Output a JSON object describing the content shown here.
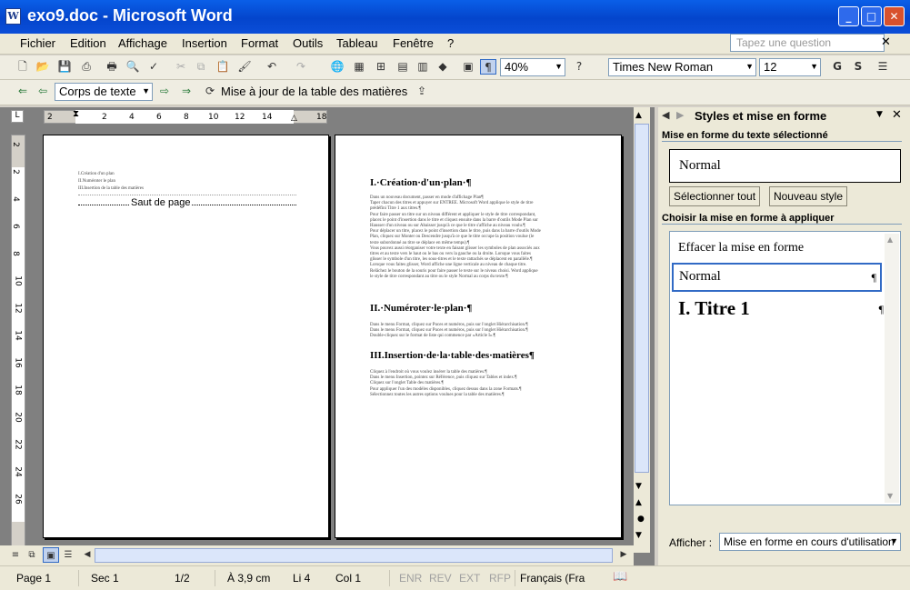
{
  "window": {
    "title": "exo9.doc - Microsoft Word"
  },
  "menu": [
    "Fichier",
    "Edition",
    "Affichage",
    "Insertion",
    "Format",
    "Outils",
    "Tableau",
    "Fenêtre",
    "?"
  ],
  "ask_placeholder": "Tapez une question",
  "toolbar": {
    "zoom": "40%",
    "font": "Times New Roman",
    "size": "12",
    "bold": "G",
    "shadow": "S"
  },
  "outline_bar": {
    "style": "Corps de texte",
    "update_toc": "Mise à jour de la table des matières"
  },
  "ruler": {
    "h": [
      "2",
      "2",
      "4",
      "6",
      "8",
      "10",
      "12",
      "14",
      "18"
    ],
    "v": [
      "2",
      "2",
      "4",
      "6",
      "8",
      "10",
      "12",
      "14",
      "16",
      "18",
      "20",
      "22",
      "24",
      "26"
    ]
  },
  "page1": {
    "toc": [
      "I.Création d'un plan",
      "II.Numéroter le plan",
      "III.Insertion de la table des matières"
    ],
    "page_break": "Saut de page"
  },
  "page2": {
    "h1": "I.·Création·d'un·plan·¶",
    "h2": "II.·Numéroter·le·plan·¶",
    "h3": "III.Insertion·de·la·table·des·matières¶",
    "p1": [
      "Dans un nouveau document, passer en mode d'affichage Plan¶",
      "Taper chacun des titres et appuyer sur ENTREE. Microsoft Word applique le style de titre",
      "prédéfini Titre 1 aux titres.¶",
      "Pour faire passer un titre sur un niveau différent et appliquer le style de titre correspondant,",
      "placez le point d'insertion dans le titre et cliquez ensuite dans la barre d'outils Mode Plan sur",
      "Hausser d'un niveau ou sur Abaisser jusqu'à ce que le titre s'affiche au niveau voulu.¶",
      "Pour déplacer un titre, placez le point d'insertion dans le titre, puis dans la barre d'outils Mode",
      "Plan, cliquez sur Monter ou Descendre jusqu'à ce que le titre occupe la position voulue (le",
      "texte subordonné au titre se déplace en même temps).¶",
      "Vous pouvez aussi réorganiser votre texte en faisant glisser les symboles de plan associés aux",
      "titres et au texte vers le haut ou le bas ou vers la gauche ou la droite. Lorsque vous faites",
      "glisser le symbole d'un titre, les sous-titres et le texte rattachés se déplacent en parallèle.¶",
      "Lorsque vous faites glisser, Word affiche une ligne verticale au niveau de chaque titre.",
      "Relâchez le bouton de la souris pour faire passer le texte sur le niveau choisi. Word applique",
      "le style de titre correspondant au titre ou le style Normal au corps du texte.¶"
    ],
    "p2": [
      "Dans le menu Format, cliquez sur Puces et numéros, puis sur l'onglet Hiérarchisation.¶",
      "Dans le menu Format, cliquez sur Puces et numéros, puis sur l'onglet Hiérarchisation.¶",
      "Double-cliquez sur le format de liste qui commence par «Article I».¶"
    ],
    "p3": [
      "Cliquez à l'endroit où vous voulez insérer la table des matières.¶",
      "Dans le menu Insertion, pointez sur Référence, puis cliquez sur Tables et index.¶",
      "Cliquez sur l'onglet Table des matières.¶",
      "Pour appliquer l'un des modèles disponibles, cliquez dessus dans la zone Formats.¶",
      "Sélectionnez toutes les autres options voulues pour la table des matières.¶"
    ]
  },
  "taskpane": {
    "title": "Styles et mise en forme",
    "sec1": "Mise en forme du texte sélectionné",
    "current": "Normal",
    "select_all": "Sélectionner tout",
    "new_style": "Nouveau style",
    "sec2": "Choisir la mise en forme à appliquer",
    "items": [
      "Effacer la mise en forme",
      "Normal",
      "I.  Titre 1"
    ],
    "pilcrow": "¶",
    "show_label": "Afficher :",
    "show_value": "Mise en forme en cours d'utilisation"
  },
  "status": {
    "page": "Page 1",
    "sec": "Sec 1",
    "pages": "1/2",
    "at": "À 3,9 cm",
    "li": "Li 4",
    "col": "Col 1",
    "enr": "ENR",
    "rev": "REV",
    "ext": "EXT",
    "rfp": "RFP",
    "lang": "Français (Fra"
  }
}
